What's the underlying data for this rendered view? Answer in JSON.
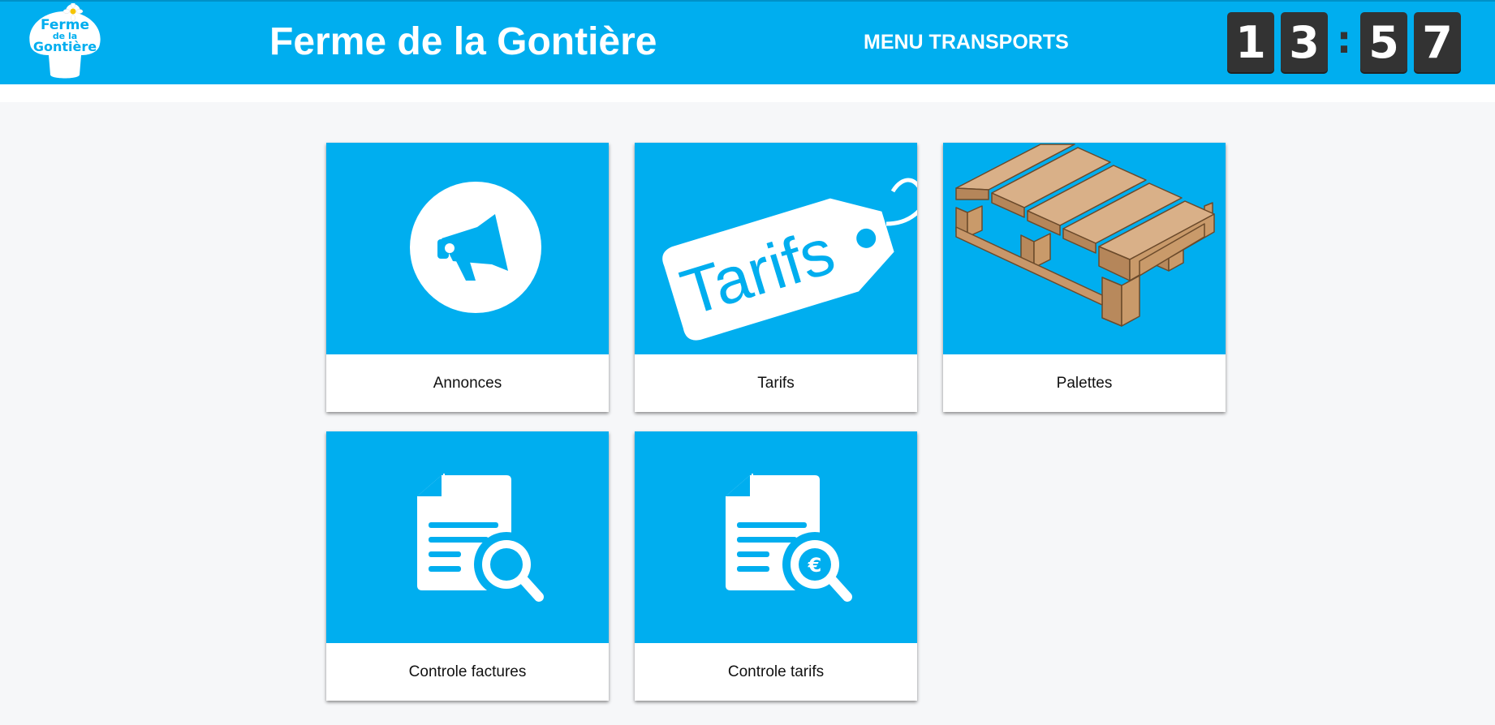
{
  "header": {
    "logo_text": [
      "Ferme",
      "de la",
      "Gontière"
    ],
    "site_title": "Ferme de la Gontière",
    "menu_title": "MENU TRANSPORTS",
    "clock": {
      "h1": "1",
      "h2": "3",
      "sep": ":",
      "m1": "5",
      "m2": "7"
    }
  },
  "tiles": [
    {
      "label": "Annonces",
      "icon": "megaphone-icon"
    },
    {
      "label": "Tarifs",
      "icon": "price-tag-icon",
      "art_text": "Tarifs"
    },
    {
      "label": "Palettes",
      "icon": "pallet-icon"
    },
    {
      "label": "Controle factures",
      "icon": "document-search-icon"
    },
    {
      "label": "Controle tarifs",
      "icon": "document-euro-search-icon",
      "art_symbol": "€"
    }
  ],
  "colors": {
    "primary": "#00aeef",
    "clock_digit_bg": "#333333",
    "background": "#f6f7f9",
    "pallet_wood": "#d2a77a"
  }
}
